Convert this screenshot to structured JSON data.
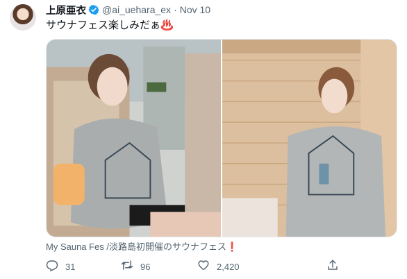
{
  "tweet": {
    "author": {
      "display_name": "上原亜衣",
      "handle": "@ai_uehara_ex",
      "verified": true,
      "avatar_icon": "avatar-photo"
    },
    "separator": "·",
    "timestamp": "Nov 10",
    "text": "サウナフェス楽しみだぁ♨️",
    "media": [
      {
        "icon": "photo-lounge-chair"
      },
      {
        "icon": "photo-sauna-room"
      }
    ],
    "card_caption": "My Sauna Fes /淡路島初開催のサウナフェス",
    "card_caption_mark": "❗",
    "actions": {
      "reply": {
        "icon": "reply-icon",
        "count": "31"
      },
      "retweet": {
        "icon": "retweet-icon",
        "count": "96"
      },
      "like": {
        "icon": "heart-icon",
        "count": "2,420"
      },
      "share": {
        "icon": "share-icon"
      }
    }
  },
  "colors": {
    "text_primary": "#0f1419",
    "text_secondary": "#536471",
    "verified": "#1d9bf0",
    "border": "#e6ecf0"
  }
}
